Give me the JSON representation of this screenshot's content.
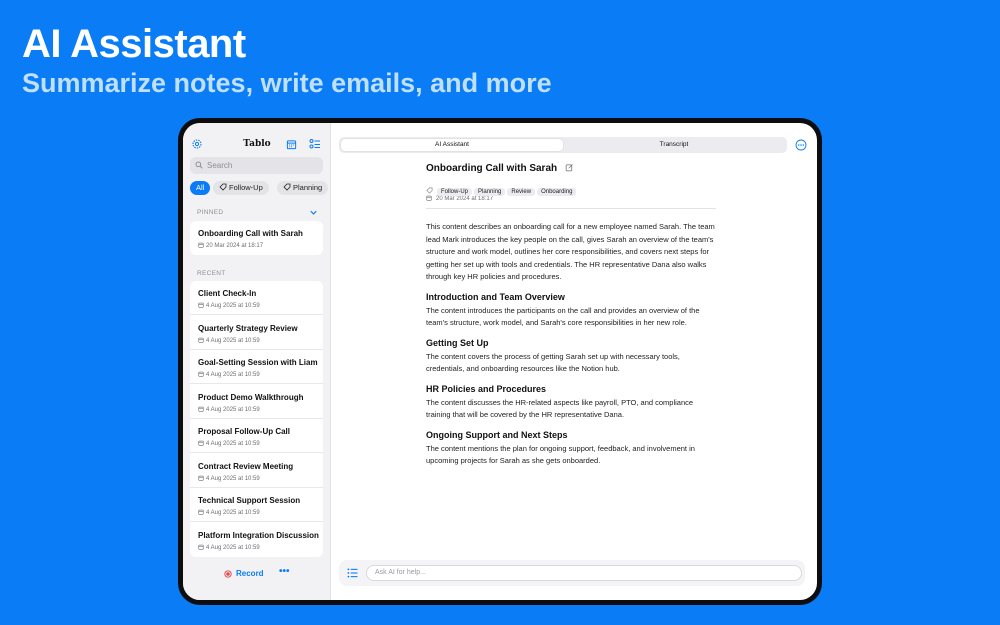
{
  "hero": {
    "title": "AI Assistant",
    "subtitle": "Summarize notes, write emails, and more"
  },
  "sidebar": {
    "app_title": "Tablo",
    "search_placeholder": "Search",
    "filters": [
      "All",
      "Follow-Up",
      "Planning"
    ],
    "pinned_label": "PINNED",
    "recent_label": "RECENT",
    "pinned": [
      {
        "title": "Onboarding Call with Sarah",
        "date": "20 Mar 2024 at 18:17"
      }
    ],
    "recent": [
      {
        "title": "Client Check-In",
        "date": "4 Aug 2025 at 10:59"
      },
      {
        "title": "Quarterly Strategy Review",
        "date": "4 Aug 2025 at 10:59"
      },
      {
        "title": "Goal-Setting Session with Liam",
        "date": "4 Aug 2025 at 10:59"
      },
      {
        "title": "Product Demo Walkthrough",
        "date": "4 Aug 2025 at 10:59"
      },
      {
        "title": "Proposal Follow-Up Call",
        "date": "4 Aug 2025 at 10:59"
      },
      {
        "title": "Contract Review Meeting",
        "date": "4 Aug 2025 at 10:59"
      },
      {
        "title": "Technical Support Session",
        "date": "4 Aug 2025 at 10:59"
      },
      {
        "title": "Platform Integration Discussion",
        "date": "4 Aug 2025 at 10:59"
      }
    ],
    "record_label": "Record",
    "more_label": "•••"
  },
  "tabs": [
    "AI Assistant",
    "Transcript"
  ],
  "document": {
    "title": "Onboarding Call with Sarah",
    "tags": [
      "Follow-Up",
      "Planning",
      "Review",
      "Onboarding"
    ],
    "date": "20 Mar 2024 at 18:17",
    "intro": "This content describes an onboarding call for a new employee named Sarah. The team lead Mark introduces the key people on the call, gives Sarah an overview of the team's structure and work model, outlines her core responsibilities, and covers next steps for getting her set up with tools and credentials. The HR representative Dana also walks through key HR policies and procedures.",
    "sections": [
      {
        "heading": "Introduction and Team Overview",
        "body": "The content introduces the participants on the call and provides an overview of the team's structure, work model, and Sarah's core responsibilities in her new role."
      },
      {
        "heading": "Getting Set Up",
        "body": "The content covers the process of getting Sarah set up with necessary tools, credentials, and onboarding resources like the Notion hub."
      },
      {
        "heading": "HR Policies and Procedures",
        "body": "The content discusses the HR-related aspects like payroll, PTO, and compliance training that will be covered by the HR representative Dana."
      },
      {
        "heading": "Ongoing Support and Next Steps",
        "body": "The content mentions the plan for ongoing support, feedback, and involvement in upcoming projects for Sarah as she gets onboarded."
      }
    ]
  },
  "chat": {
    "placeholder": "Ask AI for help..."
  },
  "colors": {
    "background": "#0a7cf5",
    "accent": "#0a7cf5",
    "record": "#e5484d"
  },
  "icons": [
    "gear-icon",
    "calendar-icon",
    "checklist-icon",
    "search-icon",
    "tag-icon",
    "chevron-down-icon",
    "edit-icon",
    "more-icon",
    "list-icon",
    "record-icon"
  ]
}
